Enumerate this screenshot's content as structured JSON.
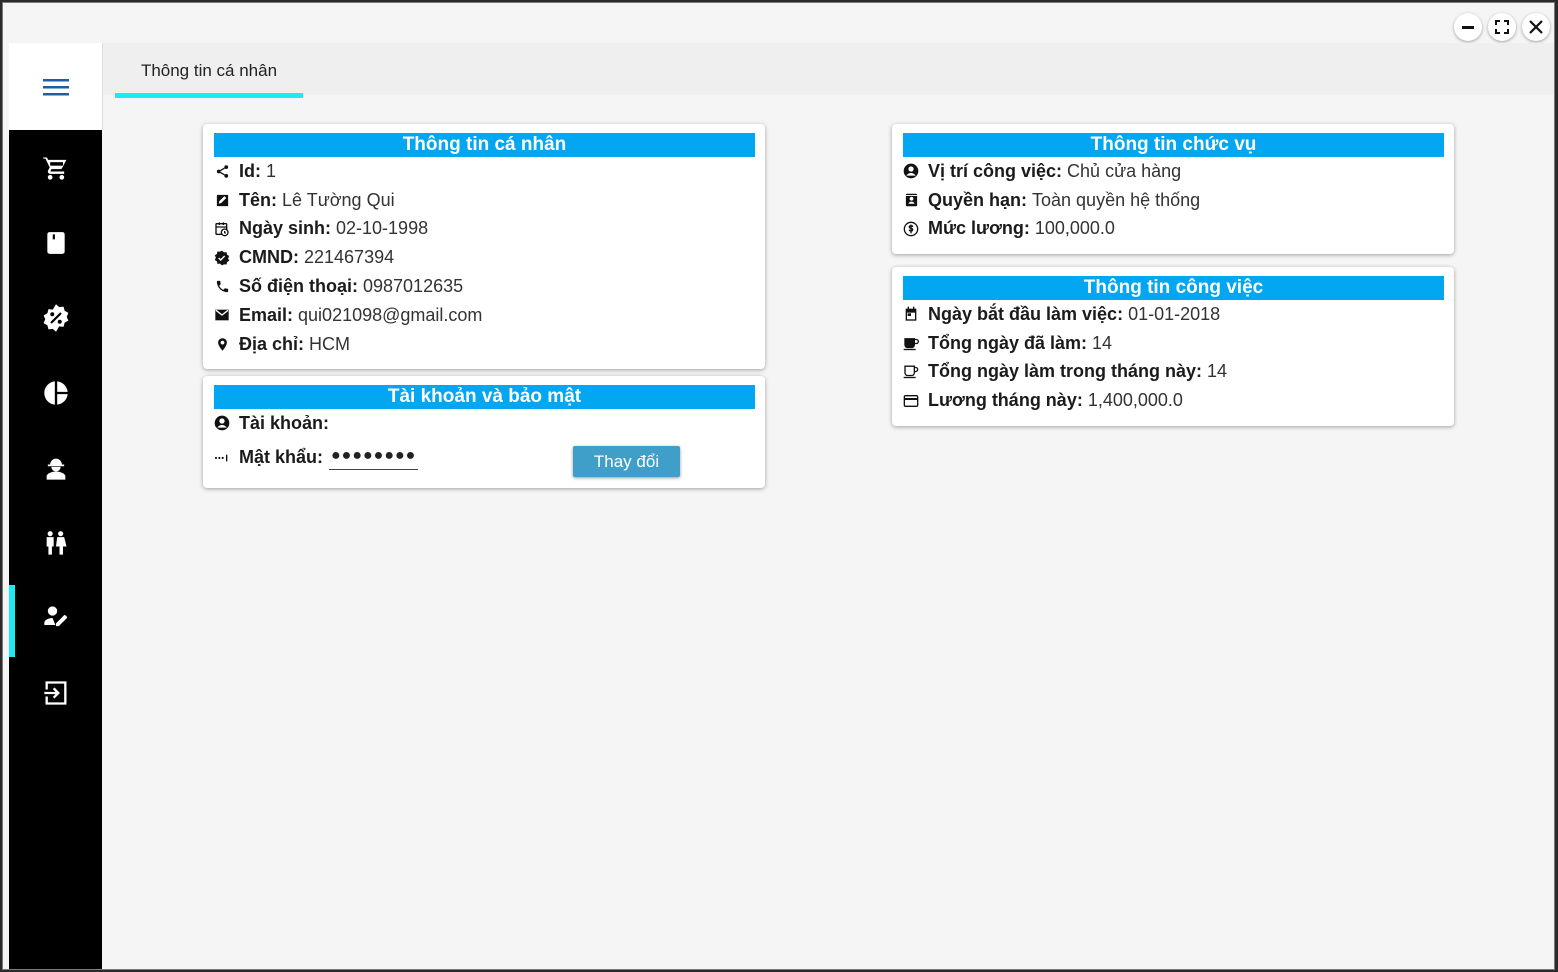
{
  "tab": {
    "label": "Thông tin cá nhân"
  },
  "sidebar": {
    "items": [
      {
        "icon": "cart-icon"
      },
      {
        "icon": "book-icon"
      },
      {
        "icon": "discount-icon"
      },
      {
        "icon": "pie-chart-icon"
      },
      {
        "icon": "worker-icon"
      },
      {
        "icon": "customers-icon"
      },
      {
        "icon": "user-edit-icon"
      },
      {
        "icon": "logout-icon"
      }
    ]
  },
  "personal": {
    "title": "Thông tin cá nhân",
    "id_label": "Id:",
    "id_value": "1",
    "name_label": "Tên:",
    "name_value": "Lê Tường Qui",
    "dob_label": "Ngày sinh:",
    "dob_value": "02-10-1998",
    "cmnd_label": "CMND:",
    "cmnd_value": "221467394",
    "phone_label": "Số điện thoại:",
    "phone_value": "0987012635",
    "email_label": "Email:",
    "email_value": "qui021098@gmail.com",
    "address_label": "Địa chỉ:",
    "address_value": "HCM"
  },
  "account": {
    "title": "Tài khoản và bảo mật",
    "username_label": "Tài khoản:",
    "username_value": "",
    "password_label": "Mật khẩu:",
    "password_value": "●●●●●●●●",
    "change_button": "Thay đổi"
  },
  "position": {
    "title": "Thông tin chức vụ",
    "job_label": "Vị trí công việc:",
    "job_value": "Chủ cửa hàng",
    "permission_label": "Quyền hạn:",
    "permission_value": "Toàn quyền hệ thống",
    "salary_label": "Mức lương:",
    "salary_value": "100,000.0"
  },
  "work": {
    "title": "Thông tin công việc",
    "start_label": "Ngày bắt đầu làm việc:",
    "start_value": "01-01-2018",
    "total_days_label": "Tổng ngày đã làm:",
    "total_days_value": "14",
    "month_days_label": "Tổng ngày làm trong tháng này:",
    "month_days_value": "14",
    "month_salary_label": "Lương tháng này:",
    "month_salary_value": "1,400,000.0"
  },
  "colors": {
    "accent": "#03a6f0",
    "tab_indicator": "#1ee9f2",
    "sidebar": "#000000",
    "button": "#3f9fc9"
  }
}
